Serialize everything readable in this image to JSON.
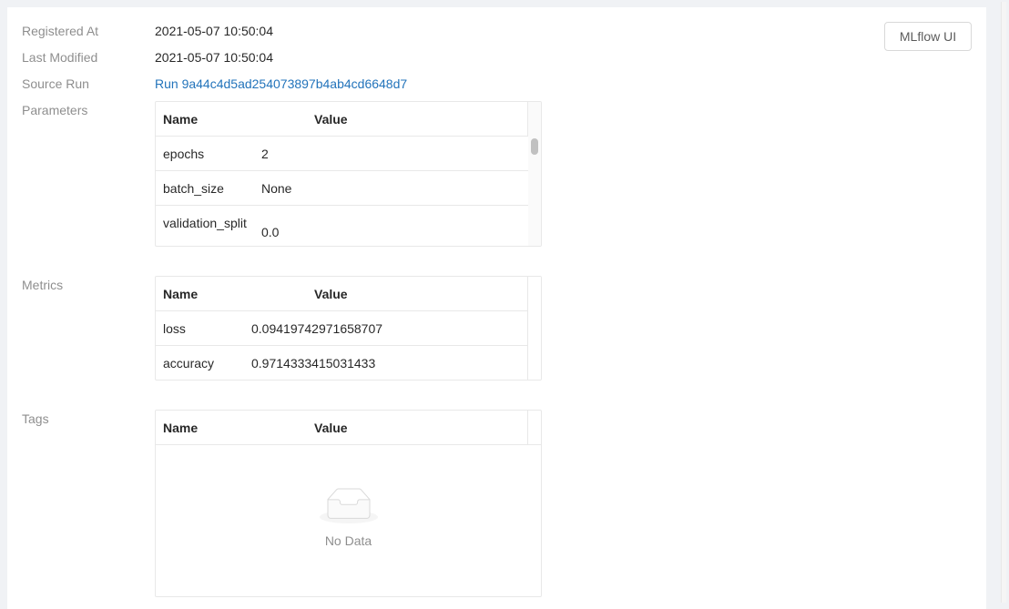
{
  "details": {
    "registered_at_label": "Registered At",
    "registered_at_value": "2021-05-07 10:50:04",
    "last_modified_label": "Last Modified",
    "last_modified_value": "2021-05-07 10:50:04",
    "source_run_label": "Source Run",
    "source_run_value": "Run 9a44c4d5ad254073897b4ab4cd6648d7"
  },
  "toolbar": {
    "mlflow_ui_label": "MLflow UI"
  },
  "parameters": {
    "label": "Parameters",
    "columns": [
      "Name",
      "Value"
    ],
    "rows": [
      {
        "name": "epochs",
        "value": "2"
      },
      {
        "name": "batch_size",
        "value": "None"
      },
      {
        "name": "validation_split",
        "value": "0.0"
      }
    ]
  },
  "metrics": {
    "label": "Metrics",
    "columns": [
      "Name",
      "Value"
    ],
    "rows": [
      {
        "name": "loss",
        "value": "0.09419742971658707"
      },
      {
        "name": "accuracy",
        "value": "0.9714333415031433"
      }
    ]
  },
  "tags": {
    "label": "Tags",
    "columns": [
      "Name",
      "Value"
    ],
    "empty_text": "No Data",
    "empty_icon": "inbox-icon"
  }
}
